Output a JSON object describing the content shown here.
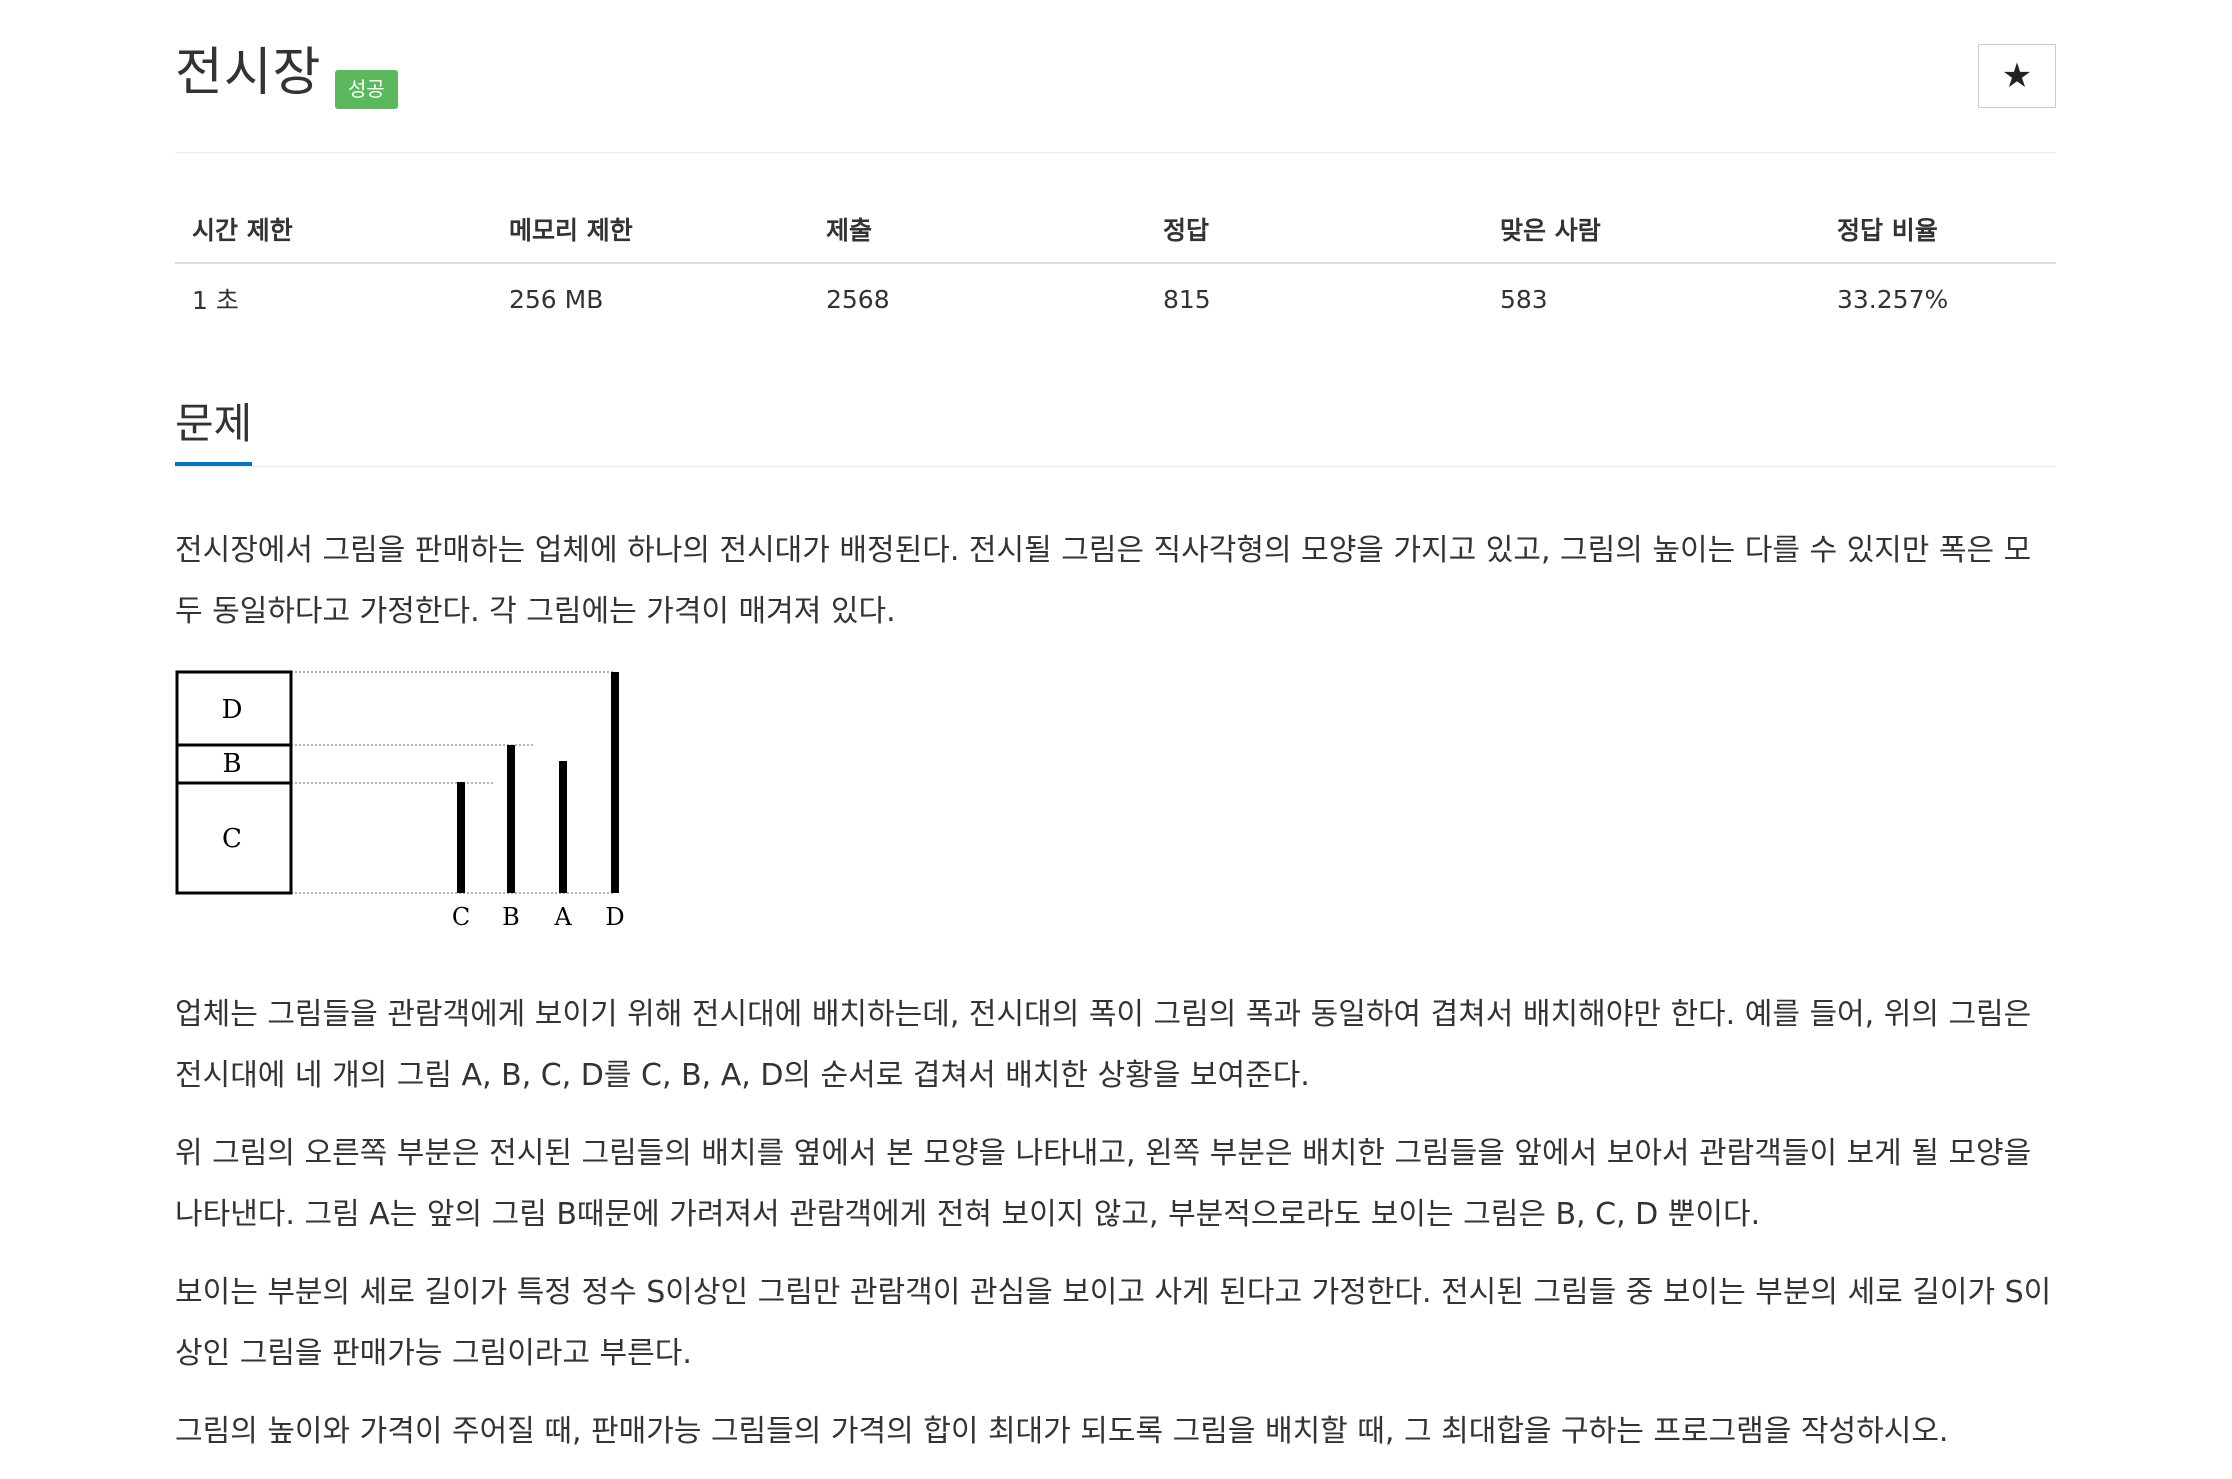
{
  "problem": {
    "title": "전시장",
    "status_badge": "성공",
    "favorite_icon": "★"
  },
  "info_table": {
    "headers": [
      "시간 제한",
      "메모리 제한",
      "제출",
      "정답",
      "맞은 사람",
      "정답 비율"
    ],
    "values": [
      "1 초",
      "256 MB",
      "2568",
      "815",
      "583",
      "33.257%"
    ]
  },
  "section": {
    "title": "문제"
  },
  "paragraphs": [
    "전시장에서 그림을 판매하는 업체에 하나의 전시대가 배정된다. 전시될 그림은 직사각형의 모양을 가지고 있고, 그림의 높이는 다를 수 있지만 폭은 모두 동일하다고 가정한다. 각 그림에는 가격이 매겨져 있다.",
    "업체는 그림들을 관람객에게 보이기 위해 전시대에 배치하는데, 전시대의 폭이 그림의 폭과 동일하여 겹쳐서 배치해야만 한다. 예를 들어, 위의 그림은 전시대에 네 개의 그림 A, B, C, D를 C, B, A, D의 순서로 겹쳐서 배치한 상황을 보여준다.",
    "위 그림의 오른쪽 부분은 전시된 그림들의 배치를 옆에서 본 모양을 나타내고, 왼쪽 부분은 배치한 그림들을 앞에서 보아서 관람객들이 보게 될 모양을 나타낸다. 그림 A는 앞의 그림 B때문에 가려져서 관람객에게 전혀 보이지 않고, 부분적으로라도 보이는 그림은 B, C, D 뿐이다.",
    "보이는 부분의 세로 길이가 특정 정수 S이상인 그림만 관람객이 관심을 보이고 사게 된다고 가정한다. 전시된 그림들 중 보이는 부분의 세로 길이가 S이상인 그림을 판매가능 그림이라고 부른다.",
    "그림의 높이와 가격이 주어질 때, 판매가능 그림들의 가격의 합이 최대가 되도록 그림을 배치할 때, 그 최대합을 구하는 프로그램을 작성하시오."
  ],
  "figure": {
    "front_labels": [
      "D",
      "B",
      "C"
    ],
    "side_labels": [
      "C",
      "B",
      "A",
      "D"
    ]
  }
}
